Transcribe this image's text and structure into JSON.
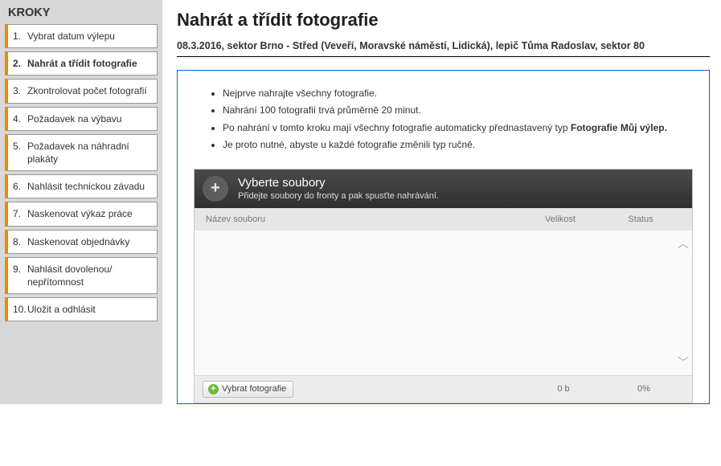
{
  "sidebar": {
    "title": "KROKY",
    "items": [
      {
        "num": "1.",
        "label": "Vybrat datum výlepu"
      },
      {
        "num": "2.",
        "label": "Nahrát a třídit fotografie"
      },
      {
        "num": "3.",
        "label": "Zkontrolovat počet fotografií"
      },
      {
        "num": "4.",
        "label": "Požadavek na výbavu"
      },
      {
        "num": "5.",
        "label": "Požadavek na náhradní plakáty"
      },
      {
        "num": "6.",
        "label": "Nahlásit technickou závadu"
      },
      {
        "num": "7.",
        "label": "Naskenovat výkaz práce"
      },
      {
        "num": "8.",
        "label": "Naskenovat objednávky"
      },
      {
        "num": "9.",
        "label": "Nahlásit dovolenou/ nepřítomnost"
      },
      {
        "num": "10.",
        "label": "Uložit a odhlásit"
      }
    ],
    "active_index": 1
  },
  "page": {
    "title": "Nahrát a třídit fotografie",
    "context": "08.3.2016, sektor Brno - Střed (Veveří, Moravské náměstí, Lidická), lepič Tůma Radoslav, sektor 80"
  },
  "intro": {
    "items": [
      "Nejprve nahrajte všechny fotografie.",
      "Nahrání 100 fotografií trvá průměrně 20 minut.",
      {
        "pre": "Po nahrání v tomto kroku mají všechny fotografie automaticky přednastavený typ ",
        "bold": "Fotografie Můj výlep."
      },
      "Je proto nutné, abyste u každé fotografie změnili typ ručně."
    ]
  },
  "uploader": {
    "header_title": "Vyberte soubory",
    "header_subtitle": "Přidejte soubory do fronty a pak spusťte nahrávání.",
    "columns": {
      "name": "Název souboru",
      "size": "Velikost",
      "status": "Status"
    },
    "select_button": "Vybrat fotografie",
    "footer": {
      "size": "0 b",
      "progress": "0%"
    }
  }
}
